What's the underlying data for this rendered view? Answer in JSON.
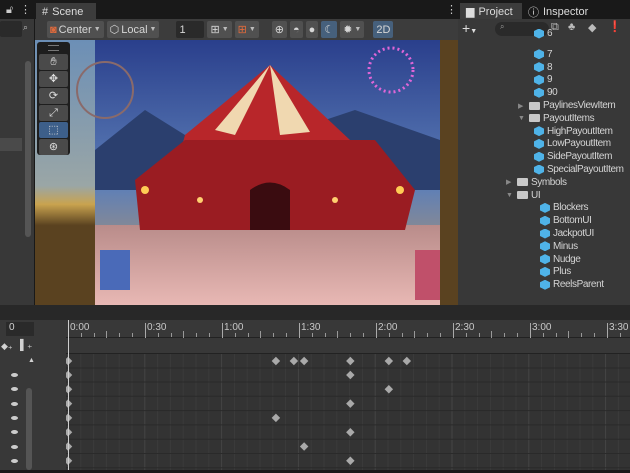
{
  "left_panel": {
    "search_value": ""
  },
  "scene_tab": {
    "label": "Scene"
  },
  "toolbar": {
    "pivot": "Center",
    "space": "Local",
    "grid_value": "1",
    "mode_2d": "2D"
  },
  "tool_palette": {
    "tools": [
      "hand",
      "move",
      "rotate",
      "scale",
      "rect",
      "transform"
    ],
    "active": "rect"
  },
  "right_panel": {
    "tabs": [
      {
        "label": "Project"
      },
      {
        "label": "Inspector"
      }
    ],
    "search_value": "",
    "tree": [
      {
        "label": "6",
        "type": "prefab",
        "depth": 3
      },
      {
        "label": "7",
        "type": "prefab",
        "depth": 3
      },
      {
        "label": "8",
        "type": "prefab",
        "depth": 3
      },
      {
        "label": "9",
        "type": "prefab",
        "depth": 3
      },
      {
        "label": "90",
        "type": "prefab",
        "depth": 3
      },
      {
        "label": "PaylinesViewItem",
        "type": "folder",
        "depth": 2,
        "expanded": false
      },
      {
        "label": "PayoutItems",
        "type": "folder",
        "depth": 2,
        "expanded": true
      },
      {
        "label": "HighPayoutItem",
        "type": "prefab",
        "depth": 3
      },
      {
        "label": "LowPayoutItem",
        "type": "prefab",
        "depth": 3
      },
      {
        "label": "SidePayoutItem",
        "type": "prefab",
        "depth": 3
      },
      {
        "label": "SpecialPayoutItem",
        "type": "prefab",
        "depth": 3
      },
      {
        "label": "Symbols",
        "type": "folder",
        "depth": 1,
        "expanded": false
      },
      {
        "label": "UI",
        "type": "folder",
        "depth": 1,
        "expanded": true
      },
      {
        "label": "Blockers",
        "type": "prefab",
        "depth": 2
      },
      {
        "label": "BottomUI",
        "type": "prefab",
        "depth": 2
      },
      {
        "label": "JackpotUI",
        "type": "prefab",
        "depth": 2
      },
      {
        "label": "Minus",
        "type": "prefab",
        "depth": 2
      },
      {
        "label": "Nudge",
        "type": "prefab",
        "depth": 2
      },
      {
        "label": "Plus",
        "type": "prefab",
        "depth": 2
      },
      {
        "label": "ReelsParent",
        "type": "prefab",
        "depth": 2
      }
    ]
  },
  "timeline": {
    "frame_value": "0",
    "ruler_labels": [
      "0:00",
      "0:30",
      "1:00",
      "1:30",
      "2:00",
      "2:30",
      "3:00",
      "3:30"
    ],
    "summary_keys_sec": [
      0,
      81,
      88,
      92,
      110,
      125,
      132
    ],
    "tracks": [
      {
        "keys_sec": [
          0,
          110
        ]
      },
      {
        "keys_sec": [
          0,
          125
        ]
      },
      {
        "keys_sec": [
          0,
          110
        ]
      },
      {
        "keys_sec": [
          0,
          81
        ]
      },
      {
        "keys_sec": [
          0,
          110
        ]
      },
      {
        "keys_sec": [
          0,
          92
        ]
      },
      {
        "keys_sec": [
          0,
          110
        ]
      }
    ]
  },
  "colors": {
    "accent": "#46607c",
    "prefab": "#4fb3e8",
    "panel": "#383838"
  }
}
